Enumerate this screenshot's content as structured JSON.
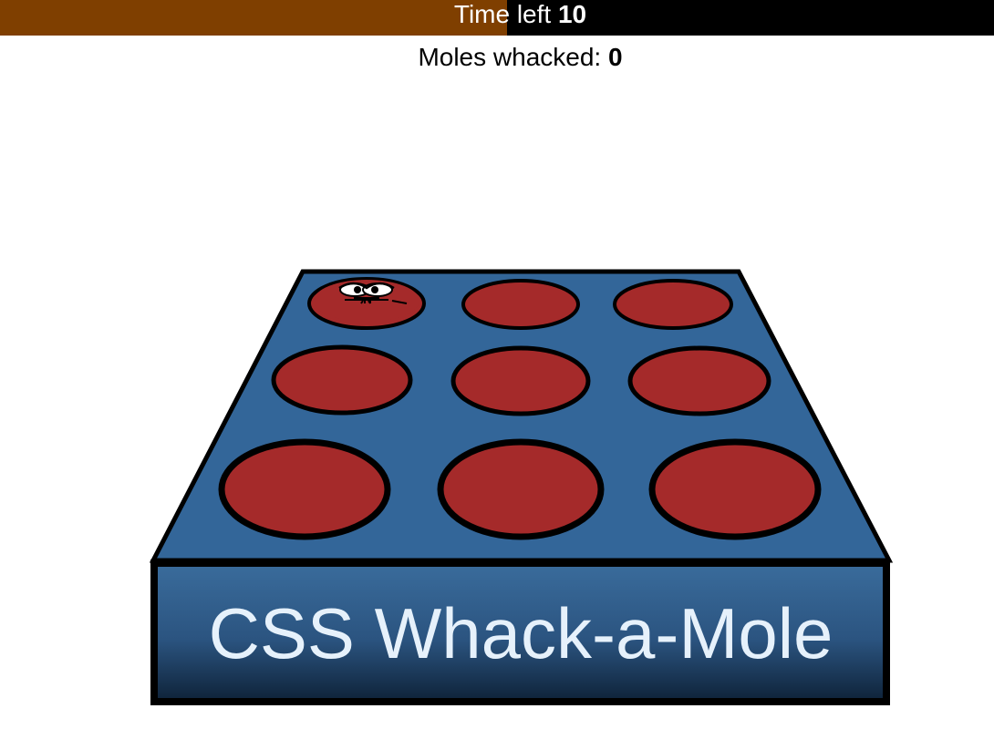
{
  "timer": {
    "label": "Time left",
    "value": "10",
    "progress_fraction": 0.51,
    "fill_color": "#7f3f00",
    "track_color": "#000000"
  },
  "score": {
    "label": "Moles whacked:",
    "value": "0"
  },
  "board": {
    "title": "CSS Whack-a-Mole",
    "top_color": "#336699",
    "front_color": "#2a5a88",
    "hole_color": "#a52a2a",
    "rows": 3,
    "cols": 3,
    "active_mole_hole": 1
  }
}
